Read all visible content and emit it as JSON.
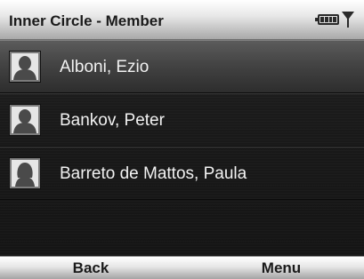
{
  "title_bar": {
    "title": "Inner Circle - Member",
    "icons": [
      "battery-icon",
      "signal-antenna-icon"
    ]
  },
  "contacts": [
    {
      "name": "Alboni, Ezio",
      "selected": true,
      "icon": "contact-silhouette-icon"
    },
    {
      "name": "Bankov, Peter",
      "selected": false,
      "icon": "contact-silhouette-icon"
    },
    {
      "name": "Barreto de Mattos, Paula",
      "selected": false,
      "icon": "contact-silhouette-female-icon"
    }
  ],
  "softkeys": {
    "left": "Back",
    "right": "Menu"
  },
  "colors": {
    "title_bar": "#e8e8e8",
    "background": "#1a1a1a",
    "selection": "#444444",
    "text": "#f2f2f2"
  }
}
